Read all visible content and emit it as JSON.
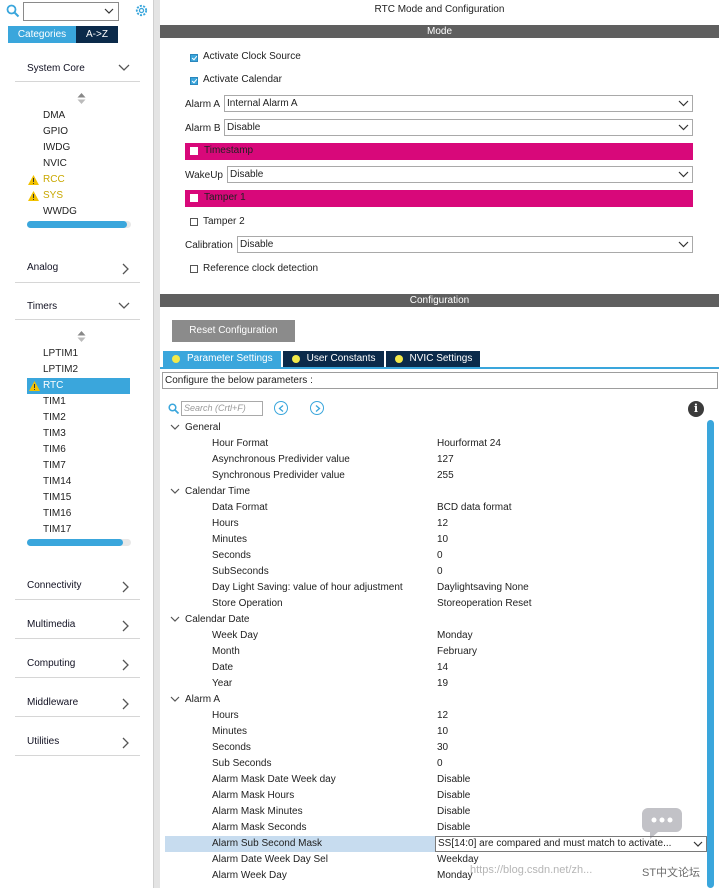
{
  "left": {
    "tabs": {
      "categories": "Categories",
      "az": "A->Z"
    },
    "sections": {
      "system_core": "System Core",
      "analog": "Analog",
      "timers": "Timers",
      "connectivity": "Connectivity",
      "multimedia": "Multimedia",
      "computing": "Computing",
      "middleware": "Middleware",
      "utilities": "Utilities"
    },
    "system_core_items": [
      "DMA",
      "GPIO",
      "IWDG",
      "NVIC",
      "RCC",
      "SYS",
      "WWDG"
    ],
    "timers_items": [
      "LPTIM1",
      "LPTIM2",
      "RTC",
      "TIM1",
      "TIM2",
      "TIM3",
      "TIM6",
      "TIM7",
      "TIM14",
      "TIM15",
      "TIM16",
      "TIM17"
    ]
  },
  "right": {
    "title": "RTC Mode and Configuration",
    "mode_bar": "Mode",
    "mode": {
      "activate_clock_source": "Activate Clock Source",
      "activate_calendar": "Activate Calendar",
      "alarm_a_label": "Alarm A",
      "alarm_a_value": "Internal Alarm A",
      "alarm_b_label": "Alarm B",
      "alarm_b_value": "Disable",
      "timestamp": "Timestamp",
      "wakeup_label": "WakeUp",
      "wakeup_value": "Disable",
      "tamper1": "Tamper 1",
      "tamper2": "Tamper 2",
      "calibration_label": "Calibration",
      "calibration_value": "Disable",
      "ref_clock": "Reference clock detection"
    },
    "config_bar": "Configuration",
    "reset_button": "Reset Configuration",
    "tabs": [
      "Parameter Settings",
      "User Constants",
      "NVIC Settings"
    ],
    "hint": "Configure the below parameters :",
    "search_placeholder": "Search (Crtl+F)",
    "info": "i",
    "params": {
      "general": "General",
      "hour_format": [
        "Hour Format",
        "Hourformat 24"
      ],
      "async_div": [
        "Asynchronous Predivider value",
        "127"
      ],
      "sync_div": [
        "Synchronous Predivider value",
        "255"
      ],
      "calendar_time": "Calendar Time",
      "data_format": [
        "Data Format",
        "BCD data format"
      ],
      "hours": [
        "Hours",
        "12"
      ],
      "minutes": [
        "Minutes",
        "10"
      ],
      "seconds": [
        "Seconds",
        "0"
      ],
      "subseconds": [
        "SubSeconds",
        "0"
      ],
      "daylight": [
        "Day Light Saving: value of hour adjustment",
        "Daylightsaving None"
      ],
      "store_op": [
        "Store Operation",
        "Storeoperation Reset"
      ],
      "calendar_date": "Calendar Date",
      "week_day": [
        "Week Day",
        "Monday"
      ],
      "month": [
        "Month",
        "February"
      ],
      "date": [
        "Date",
        "14"
      ],
      "year": [
        "Year",
        "19"
      ],
      "alarm_a": "Alarm A",
      "a_hours": [
        "Hours",
        "12"
      ],
      "a_minutes": [
        "Minutes",
        "10"
      ],
      "a_seconds": [
        "Seconds",
        "30"
      ],
      "a_subseconds": [
        "Sub Seconds",
        "0"
      ],
      "a_mask_dwd": [
        "Alarm Mask Date Week day",
        "Disable"
      ],
      "a_mask_hours": [
        "Alarm Mask Hours",
        "Disable"
      ],
      "a_mask_minutes": [
        "Alarm Mask Minutes",
        "Disable"
      ],
      "a_mask_seconds": [
        "Alarm Mask Seconds",
        "Disable"
      ],
      "a_sub_second_mask": [
        "Alarm Sub Second Mask",
        "SS[14:0] are compared and must match to activate..."
      ],
      "a_date_weekday_sel": [
        "Alarm Date Week Day Sel",
        "Weekday"
      ],
      "a_week_day": [
        "Alarm Week Day",
        "Monday"
      ]
    },
    "watermark": "https://blog.csdn.net/zh...",
    "watermark_logo": "ST中文论坛"
  },
  "colors": {
    "accent": "#3aa6dc",
    "navy": "#0b2a4a",
    "pink": "#d8087a",
    "warn": "#c9a800"
  }
}
